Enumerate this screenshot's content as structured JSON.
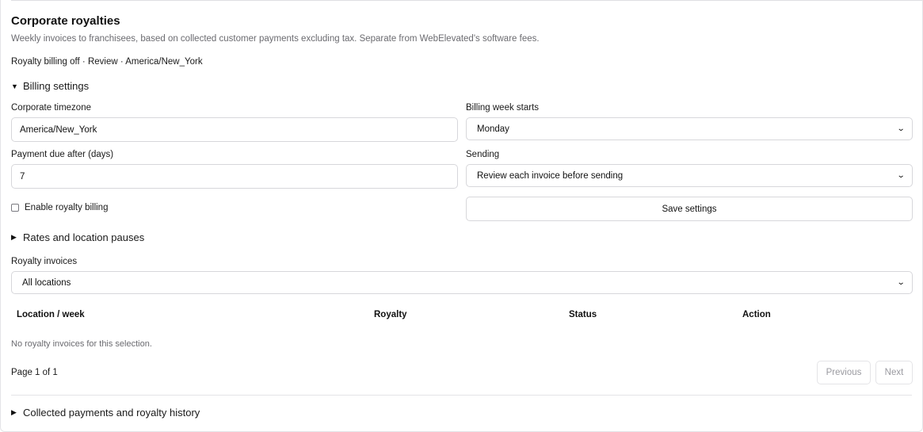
{
  "header": {
    "title": "Corporate royalties",
    "subtitle": "Weekly invoices to franchisees, based on collected customer payments excluding tax. Separate from WebElevated's software fees.",
    "summary": "Royalty billing off · Review · America/New_York"
  },
  "billing_settings": {
    "toggle_label": "Billing settings",
    "expanded": true,
    "timezone_label": "Corporate timezone",
    "timezone_value": "America/New_York",
    "week_start_label": "Billing week starts",
    "week_start_value": "Monday",
    "due_label": "Payment due after (days)",
    "due_value": "7",
    "sending_label": "Sending",
    "sending_value": "Review each invoice before sending",
    "enable_label": "Enable royalty billing",
    "enable_checked": false,
    "save_label": "Save settings"
  },
  "rates": {
    "toggle_label": "Rates and location pauses",
    "expanded": false
  },
  "invoices": {
    "label": "Royalty invoices",
    "location_filter": "All locations",
    "columns": [
      "Location / week",
      "Royalty",
      "Status",
      "Action"
    ],
    "empty_text": "No royalty invoices for this selection.",
    "page_info": "Page 1 of 1",
    "previous_label": "Previous",
    "next_label": "Next"
  },
  "history": {
    "toggle_label": "Collected payments and royalty history",
    "expanded": false
  },
  "icons": {
    "expanded": "triangle-down-icon",
    "collapsed": "triangle-right-icon",
    "select": "chevron-down-icon"
  }
}
